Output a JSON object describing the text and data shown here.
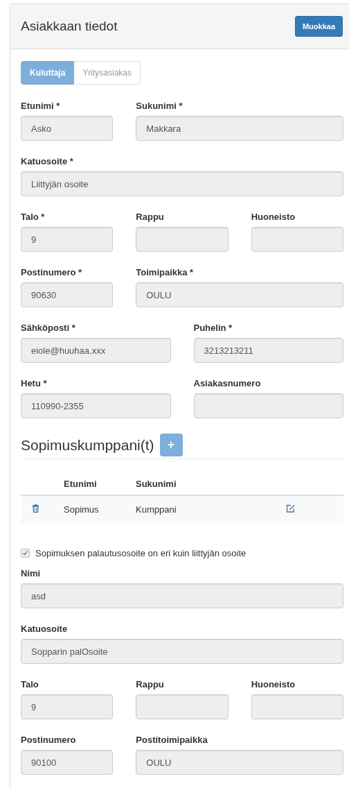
{
  "panel": {
    "title": "Asiakkaan tiedot",
    "edit_button": "Muokkaa"
  },
  "tabs": [
    {
      "label": "Kuluttaja",
      "selected": true
    },
    {
      "label": "Yritysasiakas",
      "selected": false
    }
  ],
  "customer_rows": [
    {
      "kind": "third-rest",
      "fields": [
        {
          "label": "Etunimi *",
          "value": "Asko"
        },
        {
          "label": "Sukunimi *",
          "value": "Makkara"
        }
      ]
    },
    {
      "kind": "full",
      "fields": [
        {
          "label": "Katuosoite *",
          "value": "Liittyjän osoite"
        }
      ]
    },
    {
      "kind": "thirds",
      "fields": [
        {
          "label": "Talo *",
          "value": "9"
        },
        {
          "label": "Rappu"
        },
        {
          "label": "Huoneisto"
        }
      ]
    },
    {
      "kind": "third-rest",
      "fields": [
        {
          "label": "Postinumero *",
          "value": "90630"
        },
        {
          "label": "Toimipaikka *",
          "value": "OULU"
        }
      ]
    },
    {
      "kind": "halves",
      "fields": [
        {
          "label": "Sähköposti *",
          "value": "eiole@huuhaa.xxx"
        },
        {
          "label": "Puhelin *",
          "value": "3213213211"
        }
      ]
    },
    {
      "kind": "halves",
      "fields": [
        {
          "label": "Hetu *",
          "value": "110990-2355"
        },
        {
          "label": "Asiakasnumero"
        }
      ]
    }
  ],
  "partners": {
    "title": "Sopimuskumppani(t)",
    "add_button": "+",
    "columns": [
      "Etunimi",
      "Sukunimi"
    ],
    "rows": [
      {
        "cells": [
          "Sopimus",
          "Kumppani"
        ]
      }
    ]
  },
  "return_address_checkbox": {
    "label": "Sopimuksen palautusosoite on eri kuin liittyjän osoite",
    "checked": true,
    "disabled": true
  },
  "return_rows": [
    {
      "kind": "full",
      "fields": [
        {
          "label": "Nimi",
          "value": "asd"
        }
      ]
    },
    {
      "kind": "full",
      "fields": [
        {
          "label": "Katuosoite",
          "value": "Sopparin palOsoite"
        }
      ]
    },
    {
      "kind": "thirds",
      "fields": [
        {
          "label": "Talo",
          "value": "9"
        },
        {
          "label": "Rappu"
        },
        {
          "label": "Huoneisto"
        }
      ]
    },
    {
      "kind": "third-rest",
      "fields": [
        {
          "label": "Postinumero",
          "value": "90100"
        },
        {
          "label": "Postitoimipaikka",
          "value": "OULU"
        }
      ]
    }
  ]
}
